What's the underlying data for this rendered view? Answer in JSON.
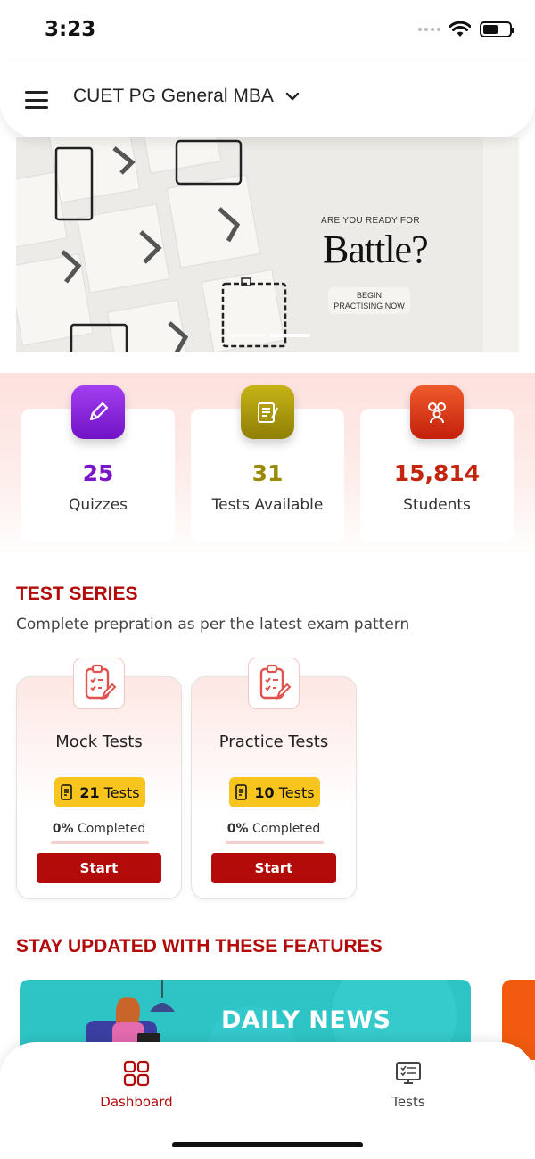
{
  "status_bar": {
    "time": "3:23"
  },
  "header": {
    "course_title": "CUET PG General MBA"
  },
  "banner": {
    "eyebrow": "ARE YOU READY FOR",
    "headline": "Battle?",
    "cta_line1": "BEGIN",
    "cta_line2": "PRACTISING NOW"
  },
  "stats": [
    {
      "value": "25",
      "label": "Quizzes",
      "color": "#7b16c9",
      "icon": "pencil-icon"
    },
    {
      "value": "31",
      "label": "Tests Available",
      "color": "#9a8a08",
      "icon": "test-sheet-icon"
    },
    {
      "value": "15,814",
      "label": "Students",
      "color": "#c2260e",
      "icon": "students-icon"
    }
  ],
  "test_series": {
    "title": "TEST SERIES",
    "subtitle": "Complete prepration as per the latest exam pattern",
    "cards": [
      {
        "name": "Mock Tests",
        "count": "21",
        "count_suffix": "Tests",
        "percent": "0%",
        "completed_suffix": "Completed",
        "progress": 0,
        "button": "Start"
      },
      {
        "name": "Practice Tests",
        "count": "10",
        "count_suffix": "Tests",
        "percent": "0%",
        "completed_suffix": "Completed",
        "progress": 0,
        "button": "Start"
      }
    ]
  },
  "features": {
    "title": "STAY UPDATED WITH THESE FEATURES",
    "cards": [
      {
        "label": "DAILY NEWS"
      }
    ]
  },
  "bottom_nav": [
    {
      "label": "Dashboard",
      "icon": "grid-icon",
      "active": true
    },
    {
      "label": "Tests",
      "icon": "monitor-checklist-icon",
      "active": false
    }
  ],
  "colors": {
    "accent": "#b30a0a",
    "badge": "#f8c51f",
    "feature_teal": "#2ec4c6",
    "feature_orange": "#f25b0f"
  }
}
